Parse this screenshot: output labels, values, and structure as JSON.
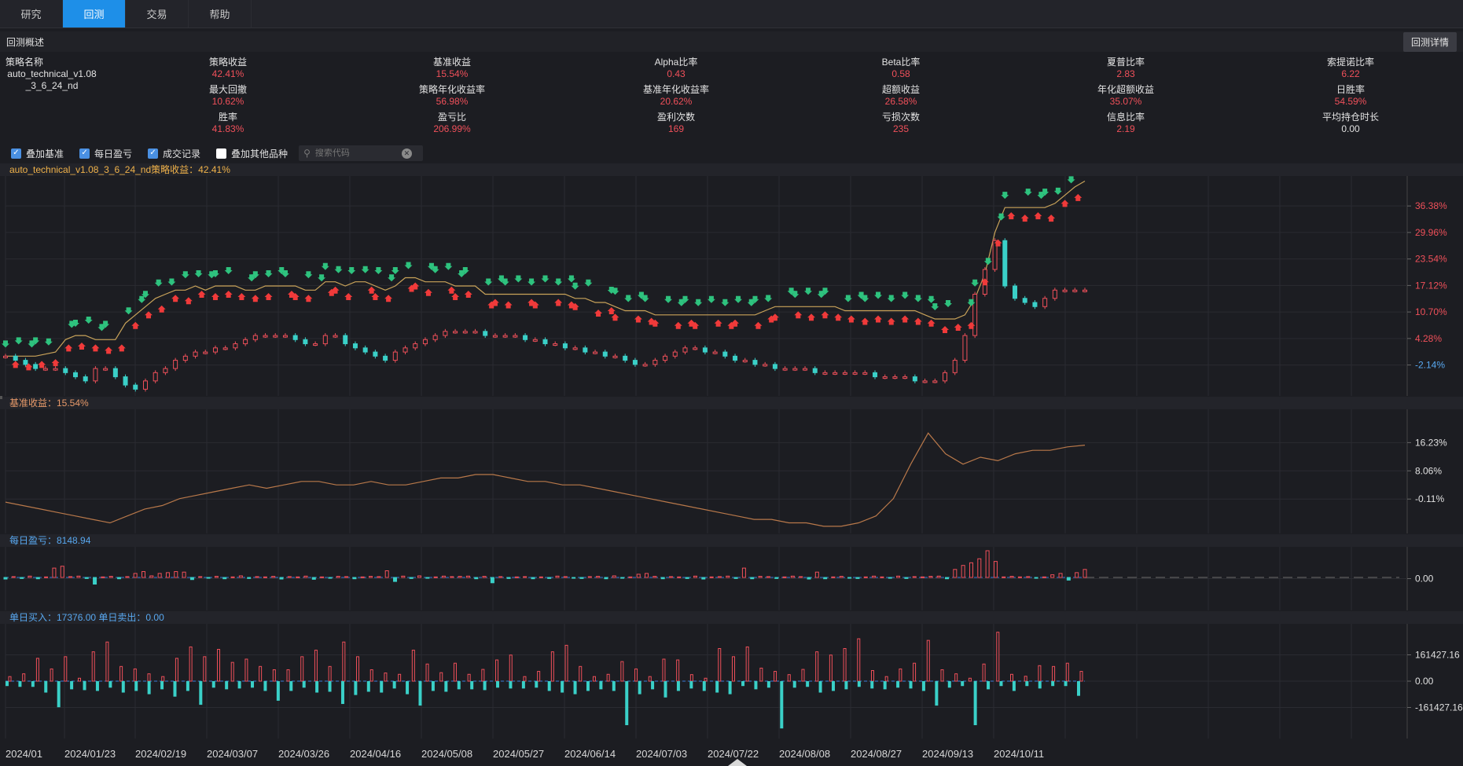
{
  "nav": {
    "tabs": [
      {
        "label": "研究",
        "active": false
      },
      {
        "label": "回测",
        "active": true
      },
      {
        "label": "交易",
        "active": false
      },
      {
        "label": "帮助",
        "active": false
      }
    ]
  },
  "summary": {
    "title": "回测概述",
    "detail_button": "回测详情",
    "strategy_label": "策略名称",
    "strategy_name": "auto_technical_v1.08_3_6_24_nd",
    "metrics": [
      {
        "label": "策略收益",
        "value": "42.41%",
        "color": "red"
      },
      {
        "label": "基准收益",
        "value": "15.54%",
        "color": "red"
      },
      {
        "label": "Alpha比率",
        "value": "0.43",
        "color": "red"
      },
      {
        "label": "Beta比率",
        "value": "0.58",
        "color": "red"
      },
      {
        "label": "夏普比率",
        "value": "2.83",
        "color": "red"
      },
      {
        "label": "索提诺比率",
        "value": "6.22",
        "color": "red"
      },
      {
        "label": "最大回撤",
        "value": "10.62%",
        "color": "red"
      },
      {
        "label": "策略年化收益率",
        "value": "56.98%",
        "color": "red"
      },
      {
        "label": "基准年化收益率",
        "value": "20.62%",
        "color": "red"
      },
      {
        "label": "超额收益",
        "value": "26.58%",
        "color": "red"
      },
      {
        "label": "年化超额收益",
        "value": "35.07%",
        "color": "red"
      },
      {
        "label": "日胜率",
        "value": "54.59%",
        "color": "red"
      },
      {
        "label": "胜率",
        "value": "41.83%",
        "color": "red"
      },
      {
        "label": "盈亏比",
        "value": "206.99%",
        "color": "red"
      },
      {
        "label": "盈利次数",
        "value": "169",
        "color": "red"
      },
      {
        "label": "亏损次数",
        "value": "235",
        "color": "red"
      },
      {
        "label": "信息比率",
        "value": "2.19",
        "color": "red"
      },
      {
        "label": "平均持仓时长",
        "value": "0.00",
        "color": "white"
      }
    ]
  },
  "options": {
    "items": [
      {
        "label": "叠加基准",
        "checked": true
      },
      {
        "label": "每日盈亏",
        "checked": true
      },
      {
        "label": "成交记录",
        "checked": true
      },
      {
        "label": "叠加其他品种",
        "checked": false
      }
    ],
    "search_placeholder": "搜索代码"
  },
  "panels": {
    "strategy_title": "auto_technical_v1.08_3_6_24_nd策略收益：42.41%",
    "benchmark_title": "基准收益：15.54%",
    "daily_pnl_title": "每日盈亏：8148.94",
    "trade_title": "单日买入：17376.00 单日卖出：0.00"
  },
  "colors": {
    "up": "#f0505a",
    "down": "#3ad0c8",
    "strategy_line": "#c9a35a",
    "benchmark_line": "#b8784a",
    "buy_marker": "#f03a3a",
    "sell_marker": "#2ec27e",
    "zero_line": "#3a7ad8"
  },
  "chart_data": [
    {
      "type": "line",
      "title": "auto_technical_v1.08_3_6_24_nd策略收益：42.41%",
      "y_ticks": [
        "36.38%",
        "29.96%",
        "23.54%",
        "17.12%",
        "10.70%",
        "4.28%",
        "-2.14%"
      ],
      "y_tick_values": [
        36.38,
        29.96,
        23.54,
        17.12,
        10.7,
        4.28,
        -2.14
      ],
      "ylim": [
        -8.5,
        42.5
      ],
      "series": [
        {
          "name": "策略收益",
          "kind": "line",
          "values": [
            0,
            0,
            0,
            0,
            0.5,
            1,
            4,
            5,
            5,
            4,
            4,
            4,
            8,
            10,
            12,
            14,
            15,
            16,
            16,
            17,
            16,
            17,
            17,
            17,
            16,
            16,
            17,
            17,
            17,
            17,
            16,
            16,
            18,
            18,
            17,
            18,
            18,
            17,
            16,
            17,
            19,
            19,
            18,
            18,
            18,
            17,
            17,
            17,
            15,
            15,
            15,
            15,
            15,
            15,
            15,
            15,
            15,
            14,
            14,
            13,
            13,
            12,
            11,
            11,
            11,
            10,
            10,
            10,
            10,
            10,
            10,
            10,
            10,
            10,
            10,
            10,
            11,
            12,
            12,
            12,
            12,
            12,
            12,
            12,
            11,
            11,
            11,
            11,
            11,
            11,
            11,
            11,
            10,
            9,
            9,
            9,
            10,
            14,
            20,
            30,
            36,
            36,
            36,
            36,
            36,
            37,
            39,
            41,
            42.4
          ]
        },
        {
          "name": "基准",
          "kind": "candlestick",
          "values": [
            0,
            -1,
            -2,
            -3,
            -3,
            -3,
            -4,
            -5,
            -6,
            -3,
            -3,
            -5,
            -7,
            -8,
            -6,
            -4,
            -3,
            -1,
            0,
            1,
            1,
            2,
            2,
            3,
            4,
            5,
            5,
            5,
            5,
            4,
            3,
            3,
            5,
            5,
            3,
            2,
            1,
            0,
            -1,
            1,
            2,
            3,
            4,
            5,
            6,
            6,
            6,
            6,
            5,
            5,
            5,
            5,
            4,
            4,
            3,
            3,
            2,
            2,
            1,
            1,
            0,
            0,
            -1,
            -2,
            -2,
            -1,
            0,
            1,
            2,
            2,
            1,
            1,
            0,
            -1,
            -1,
            -2,
            -2,
            -3,
            -3,
            -3,
            -3,
            -4,
            -4,
            -4,
            -4,
            -4,
            -4,
            -5,
            -5,
            -5,
            -5,
            -6,
            -6,
            -6,
            -4,
            -1,
            5,
            15,
            21,
            28,
            17,
            14,
            13,
            12,
            14,
            16,
            16,
            16,
            16
          ]
        }
      ],
      "buy_marker_count": 80,
      "sell_marker_count": 90
    },
    {
      "type": "line",
      "title": "基准收益：15.54%",
      "y_ticks": [
        "16.23%",
        "8.06%",
        "-0.11%"
      ],
      "y_tick_values": [
        16.23,
        8.06,
        -0.11
      ],
      "ylim": [
        -8.7,
        24.5
      ],
      "series": [
        {
          "name": "基准收益",
          "values": [
            -1,
            -2,
            -3,
            -4,
            -5,
            -6,
            -7,
            -5,
            -3,
            -2,
            0,
            1,
            2,
            3,
            4,
            3,
            4,
            5,
            5,
            4,
            4,
            5,
            4,
            4,
            5,
            6,
            6,
            7,
            7,
            6,
            5,
            5,
            4,
            4,
            3,
            2,
            1,
            0,
            -1,
            -2,
            -3,
            -4,
            -5,
            -6,
            -6,
            -7,
            -7,
            -8,
            -8,
            -7,
            -5,
            0,
            10,
            19,
            13,
            10,
            12,
            11,
            13,
            14,
            14,
            15,
            15.5
          ]
        }
      ]
    },
    {
      "type": "bar",
      "title": "每日盈亏：8148.94",
      "y_ticks": [
        "0.00"
      ],
      "y_tick_values": [
        0
      ],
      "ylim": [
        -1,
        1
      ],
      "series": [
        {
          "name": "每日盈亏",
          "values": [
            -0.06,
            0.03,
            -0.04,
            0.05,
            -0.05,
            0.02,
            0.35,
            0.42,
            0.03,
            0.05,
            -0.04,
            -0.25,
            0.02,
            0.04,
            -0.05,
            0.03,
            0.15,
            0.22,
            0.06,
            0.15,
            0.18,
            0.22,
            0.2,
            -0.08,
            0.03,
            -0.02,
            0.04,
            -0.05,
            0.02,
            0.06,
            -0.04,
            0.03,
            0.02,
            0.04,
            -0.06,
            0.03,
            0.02,
            0.05,
            -0.07,
            0.02,
            -0.03,
            0.04,
            0.03,
            -0.05,
            0.02,
            0.04,
            0.03,
            0.25,
            -0.15,
            0.05,
            -0.04,
            0.06,
            -0.03,
            0.02,
            0.05,
            0.03,
            0.04,
            0.05,
            -0.05,
            0.04,
            -0.2,
            0.03,
            -0.04,
            0.02,
            0.03,
            -0.05,
            0.02,
            -0.04,
            0.05,
            0.03,
            -0.02,
            -0.04,
            0.03,
            0.04,
            -0.05,
            0.06,
            -0.03,
            0.02,
            0.12,
            0.15,
            0.04,
            -0.05,
            0.03,
            0.02,
            -0.04,
            0.05,
            -0.06,
            0.02,
            0.03,
            0.05,
            -0.04,
            0.35,
            -0.05,
            0.04,
            0.03,
            -0.04,
            0.02,
            0.05,
            0.03,
            -0.06,
            0.2,
            -0.05,
            0.02,
            0.04,
            -0.03,
            -0.04,
            0.02,
            0.05,
            0.02,
            -0.03,
            0.05,
            -0.04,
            0.03,
            0.02,
            0.04,
            0.05,
            -0.05,
            0.3,
            0.45,
            0.55,
            0.7,
            1.0,
            0.6,
            0.02,
            0.04,
            0.02,
            0.03,
            -0.03,
            0.02,
            0.1,
            0.15,
            -0.1,
            0.18,
            0.3
          ]
        }
      ]
    },
    {
      "type": "bar",
      "title": "单日买入：17376.00 单日卖出：0.00",
      "y_ticks": [
        "161427.16",
        "0.00",
        "-161427.16"
      ],
      "y_tick_values": [
        161427.16,
        0,
        -161427.16
      ],
      "ylim": [
        -322854.32,
        322854.32
      ],
      "series": [
        {
          "name": "单日买入",
          "values": [
            28000,
            45000,
            140000,
            75000,
            150000,
            18000,
            180000,
            240000,
            90000,
            75000,
            45000,
            28000,
            140000,
            210000,
            150000,
            195000,
            115000,
            135000,
            90000,
            70000,
            70000,
            150000,
            190000,
            90000,
            240000,
            150000,
            70000,
            50000,
            42000,
            190000,
            105000,
            52000,
            110000,
            42000,
            72000,
            130000,
            160000,
            28000,
            60000,
            180000,
            220000,
            90000,
            28000,
            42000,
            120000,
            75000,
            28000,
            135000,
            130000,
            40000,
            18000,
            200000,
            150000,
            210000,
            80000,
            60000,
            40000,
            72000,
            180000,
            160000,
            200000,
            260000,
            65000,
            28000,
            75000,
            110000,
            250000,
            70000,
            45000,
            18000,
            105000,
            300000,
            42000,
            30000,
            95000,
            90000,
            110000,
            60000
          ]
        },
        {
          "name": "单日卖出",
          "values": [
            -30000,
            -35000,
            -35000,
            -70000,
            -160000,
            -50000,
            -55000,
            -60000,
            -40000,
            -70000,
            -60000,
            -80000,
            -50000,
            -95000,
            -60000,
            -145000,
            -40000,
            -50000,
            -45000,
            -40000,
            -60000,
            -120000,
            -60000,
            -40000,
            -70000,
            -65000,
            -140000,
            -85000,
            -65000,
            -70000,
            -45000,
            -80000,
            -150000,
            -60000,
            -65000,
            -50000,
            -50000,
            -55000,
            -40000,
            -45000,
            -45000,
            -40000,
            -60000,
            -70000,
            -80000,
            -60000,
            -50000,
            -60000,
            -270000,
            -80000,
            -50000,
            -100000,
            -60000,
            -45000,
            -60000,
            -70000,
            -80000,
            -30000,
            -50000,
            -40000,
            -290000,
            -40000,
            -35000,
            -70000,
            -60000,
            -50000,
            -35000,
            -45000,
            -50000,
            -40000,
            -45000,
            -60000,
            -150000,
            -40000,
            -30000,
            -270000,
            -50000,
            -30000,
            -60000,
            -30000,
            -45000,
            -30000,
            -30000,
            -90000
          ]
        }
      ]
    }
  ],
  "x_axis": {
    "labels": [
      "2024/01",
      "2024/01/23",
      "2024/02/19",
      "2024/03/07",
      "2024/03/26",
      "2024/04/16",
      "2024/05/08",
      "2024/05/27",
      "2024/06/14",
      "2024/07/03",
      "2024/07/22",
      "2024/08/08",
      "2024/08/27",
      "2024/09/13",
      "2024/10/11"
    ]
  }
}
